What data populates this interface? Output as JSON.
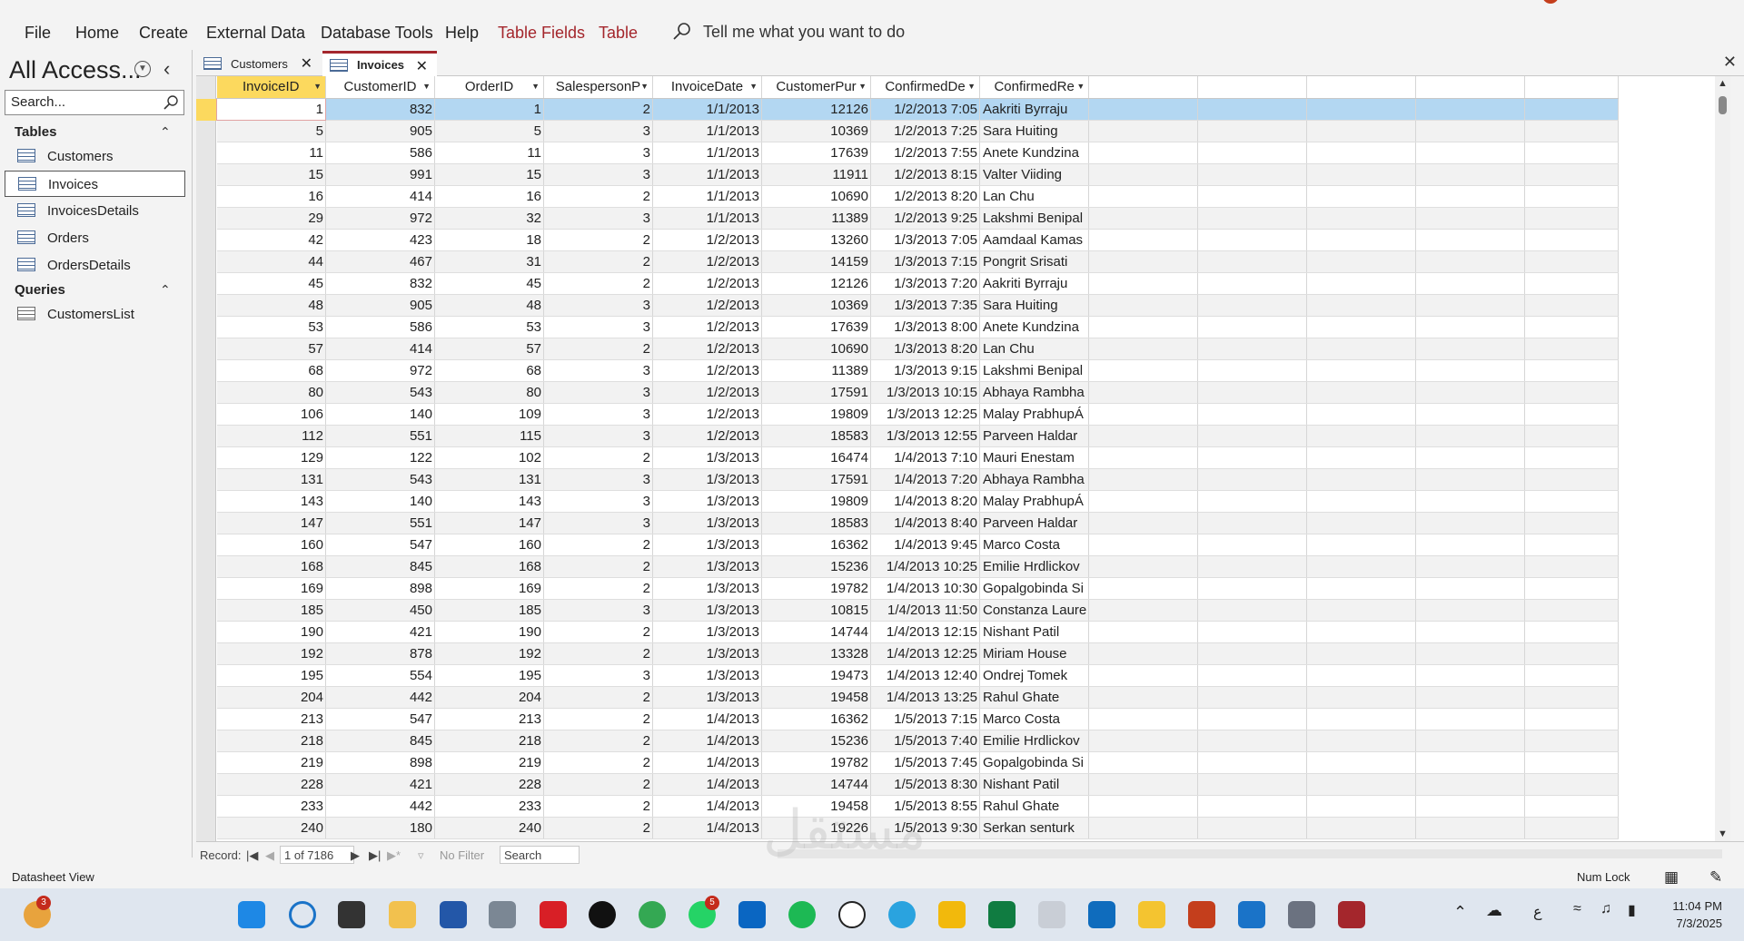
{
  "menu": {
    "items": [
      "File",
      "Home",
      "Create",
      "External Data",
      "Database Tools",
      "Help"
    ],
    "context_items": [
      "Table Fields",
      "Table"
    ],
    "tell_me": "Tell me what you want to do"
  },
  "nav": {
    "title": "All Access...",
    "search_placeholder": "Search...",
    "tables_header": "Tables",
    "tables": [
      "Customers",
      "Invoices",
      "InvoicesDetails",
      "Orders",
      "OrdersDetails"
    ],
    "selected_table": "Invoices",
    "queries_header": "Queries",
    "queries": [
      "CustomersList"
    ]
  },
  "tabs": [
    {
      "label": "Customers",
      "active": false
    },
    {
      "label": "Invoices",
      "active": true
    }
  ],
  "grid": {
    "columns": [
      "InvoiceID",
      "CustomerID",
      "OrderID",
      "SalespersonP",
      "InvoiceDate",
      "CustomerPur",
      "ConfirmedDe",
      "ConfirmedRe"
    ],
    "rows": [
      [
        "1",
        "832",
        "1",
        "2",
        "1/1/2013",
        "12126",
        "1/2/2013 7:05",
        "Aakriti Byrraju"
      ],
      [
        "5",
        "905",
        "5",
        "3",
        "1/1/2013",
        "10369",
        "1/2/2013 7:25",
        "Sara Huiting"
      ],
      [
        "11",
        "586",
        "11",
        "3",
        "1/1/2013",
        "17639",
        "1/2/2013 7:55",
        "Anete Kundzina"
      ],
      [
        "15",
        "991",
        "15",
        "3",
        "1/1/2013",
        "11911",
        "1/2/2013 8:15",
        "Valter Viiding"
      ],
      [
        "16",
        "414",
        "16",
        "2",
        "1/1/2013",
        "10690",
        "1/2/2013 8:20",
        "Lan Chu"
      ],
      [
        "29",
        "972",
        "32",
        "3",
        "1/1/2013",
        "11389",
        "1/2/2013 9:25",
        "Lakshmi Benipal"
      ],
      [
        "42",
        "423",
        "18",
        "2",
        "1/2/2013",
        "13260",
        "1/3/2013 7:05",
        "Aamdaal Kamas"
      ],
      [
        "44",
        "467",
        "31",
        "2",
        "1/2/2013",
        "14159",
        "1/3/2013 7:15",
        "Pongrit Srisati"
      ],
      [
        "45",
        "832",
        "45",
        "2",
        "1/2/2013",
        "12126",
        "1/3/2013 7:20",
        "Aakriti Byrraju"
      ],
      [
        "48",
        "905",
        "48",
        "3",
        "1/2/2013",
        "10369",
        "1/3/2013 7:35",
        "Sara Huiting"
      ],
      [
        "53",
        "586",
        "53",
        "3",
        "1/2/2013",
        "17639",
        "1/3/2013 8:00",
        "Anete Kundzina"
      ],
      [
        "57",
        "414",
        "57",
        "2",
        "1/2/2013",
        "10690",
        "1/3/2013 8:20",
        "Lan Chu"
      ],
      [
        "68",
        "972",
        "68",
        "3",
        "1/2/2013",
        "11389",
        "1/3/2013 9:15",
        "Lakshmi Benipal"
      ],
      [
        "80",
        "543",
        "80",
        "3",
        "1/2/2013",
        "17591",
        "1/3/2013 10:15",
        "Abhaya Rambha"
      ],
      [
        "106",
        "140",
        "109",
        "3",
        "1/2/2013",
        "19809",
        "1/3/2013 12:25",
        "Malay PrabhupÁ"
      ],
      [
        "112",
        "551",
        "115",
        "3",
        "1/2/2013",
        "18583",
        "1/3/2013 12:55",
        "Parveen Haldar"
      ],
      [
        "129",
        "122",
        "102",
        "2",
        "1/3/2013",
        "16474",
        "1/4/2013 7:10",
        "Mauri Enestam"
      ],
      [
        "131",
        "543",
        "131",
        "3",
        "1/3/2013",
        "17591",
        "1/4/2013 7:20",
        "Abhaya Rambha"
      ],
      [
        "143",
        "140",
        "143",
        "3",
        "1/3/2013",
        "19809",
        "1/4/2013 8:20",
        "Malay PrabhupÁ"
      ],
      [
        "147",
        "551",
        "147",
        "3",
        "1/3/2013",
        "18583",
        "1/4/2013 8:40",
        "Parveen Haldar"
      ],
      [
        "160",
        "547",
        "160",
        "2",
        "1/3/2013",
        "16362",
        "1/4/2013 9:45",
        "Marco Costa"
      ],
      [
        "168",
        "845",
        "168",
        "2",
        "1/3/2013",
        "15236",
        "1/4/2013 10:25",
        "Emilie Hrdlickov"
      ],
      [
        "169",
        "898",
        "169",
        "2",
        "1/3/2013",
        "19782",
        "1/4/2013 10:30",
        "Gopalgobinda Si"
      ],
      [
        "185",
        "450",
        "185",
        "3",
        "1/3/2013",
        "10815",
        "1/4/2013 11:50",
        "Constanza Laure"
      ],
      [
        "190",
        "421",
        "190",
        "2",
        "1/3/2013",
        "14744",
        "1/4/2013 12:15",
        "Nishant Patil"
      ],
      [
        "192",
        "878",
        "192",
        "2",
        "1/3/2013",
        "13328",
        "1/4/2013 12:25",
        "Miriam House"
      ],
      [
        "195",
        "554",
        "195",
        "3",
        "1/3/2013",
        "19473",
        "1/4/2013 12:40",
        "Ondrej Tomek"
      ],
      [
        "204",
        "442",
        "204",
        "2",
        "1/3/2013",
        "19458",
        "1/4/2013 13:25",
        "Rahul Ghate"
      ],
      [
        "213",
        "547",
        "213",
        "2",
        "1/4/2013",
        "16362",
        "1/5/2013 7:15",
        "Marco Costa"
      ],
      [
        "218",
        "845",
        "218",
        "2",
        "1/4/2013",
        "15236",
        "1/5/2013 7:40",
        "Emilie Hrdlickov"
      ],
      [
        "219",
        "898",
        "219",
        "2",
        "1/4/2013",
        "19782",
        "1/5/2013 7:45",
        "Gopalgobinda Si"
      ],
      [
        "228",
        "421",
        "228",
        "2",
        "1/4/2013",
        "14744",
        "1/5/2013 8:30",
        "Nishant Patil"
      ],
      [
        "233",
        "442",
        "233",
        "2",
        "1/4/2013",
        "19458",
        "1/5/2013 8:55",
        "Rahul Ghate"
      ],
      [
        "240",
        "180",
        "240",
        "2",
        "1/4/2013",
        "19226",
        "1/5/2013 9:30",
        "Serkan senturk"
      ]
    ]
  },
  "record_nav": {
    "label": "Record:",
    "position": "1 of 7186",
    "filter": "No Filter",
    "search": "Search"
  },
  "status": {
    "view": "Datasheet View",
    "num_lock": "Num Lock"
  },
  "taskbar": {
    "time": "11:04 PM",
    "date": "7/3/2025",
    "lang": "ع",
    "badge_weather": "3",
    "badge_whatsapp": "5"
  },
  "watermark": "مستقل",
  "colors": {
    "accent": "#a4262c",
    "header_selected": "#fcd95e",
    "row_selected": "#b3d7f2"
  }
}
